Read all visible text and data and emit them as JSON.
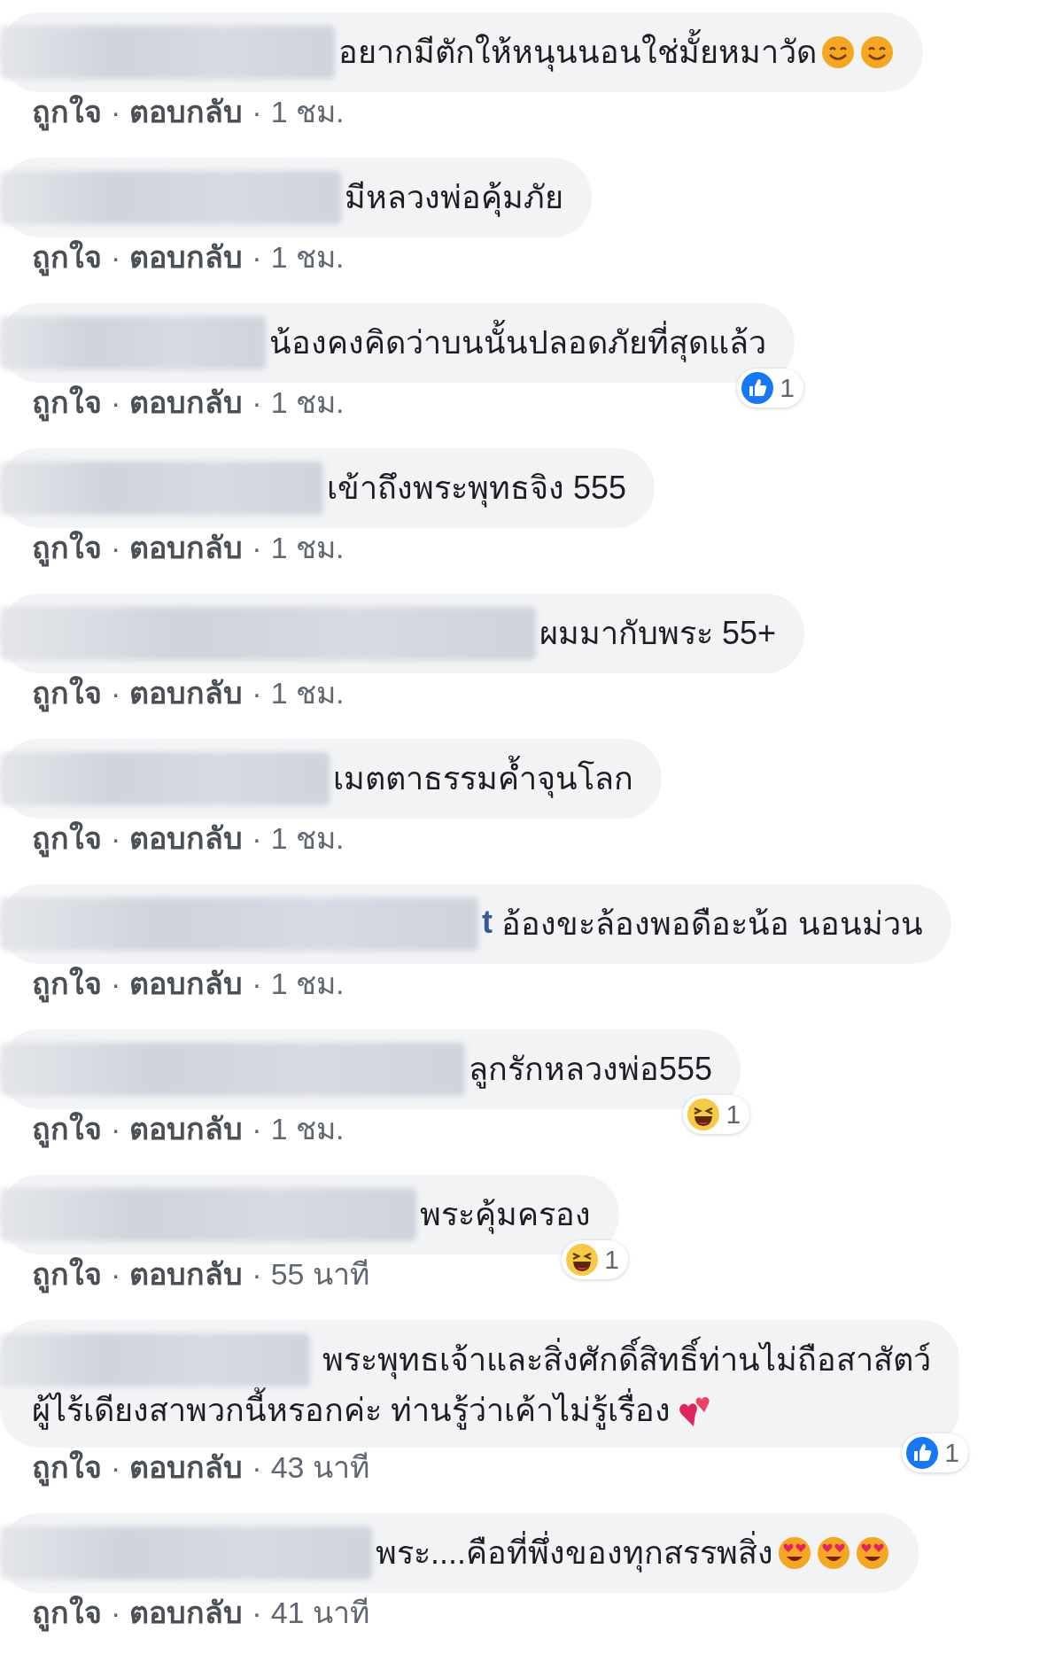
{
  "comments": [
    {
      "text": "อยากมีตักให้หนุนนอนใช่มั้ยหมาวัด",
      "emojis": [
        {
          "kind": "smiling"
        },
        {
          "kind": "smiling"
        }
      ],
      "like_label": "ถูกใจ",
      "reply_label": "ตอบกลับ",
      "separator": "·",
      "time": "1 ชม."
    },
    {
      "text": "มีหลวงพ่อคุ้มภัย",
      "like_label": "ถูกใจ",
      "reply_label": "ตอบกลับ",
      "separator": "·",
      "time": "1 ชม."
    },
    {
      "text": "น้องคงคิดว่าบนนั้นปลอดภัยที่สุดแล้ว",
      "reaction": {
        "kind": "like",
        "count": "1"
      },
      "like_label": "ถูกใจ",
      "reply_label": "ตอบกลับ",
      "separator": "·",
      "time": "1 ชม."
    },
    {
      "text": "เข้าถึงพระพุทธจิง 555",
      "like_label": "ถูกใจ",
      "reply_label": "ตอบกลับ",
      "separator": "·",
      "time": "1 ชม."
    },
    {
      "text": "ผมมากับพระ 55+",
      "like_label": "ถูกใจ",
      "reply_label": "ตอบกลับ",
      "separator": "·",
      "time": "1 ชม."
    },
    {
      "text": "เมตตาธรรมค้ำจุนโลก",
      "like_label": "ถูกใจ",
      "reply_label": "ตอบกลับ",
      "separator": "·",
      "time": "1 ชม."
    },
    {
      "name_fragment": "t",
      "text": "อ้องขะล้องพอดือะน้อ นอนม่วน",
      "like_label": "ถูกใจ",
      "reply_label": "ตอบกลับ",
      "separator": "·",
      "time": "1 ชม."
    },
    {
      "text": "ลูกรักหลวงพ่อ555",
      "reaction": {
        "kind": "haha",
        "count": "1"
      },
      "like_label": "ถูกใจ",
      "reply_label": "ตอบกลับ",
      "separator": "·",
      "time": "1 ชม."
    },
    {
      "text": "พระคุ้มครอง",
      "reaction": {
        "kind": "haha",
        "count": "1"
      },
      "like_label": "ถูกใจ",
      "reply_label": "ตอบกลับ",
      "separator": "·",
      "time": "55 นาที"
    },
    {
      "lines": [
        "พระพุทธเจ้าและสิ่งศักดิ์สิทธิ์ท่านไม่ถือสาสัตว์",
        "ผู้ไร้เดียงสาพวกนี้หรอกค่ะ ท่านรู้ว่าเค้าไม่รู้เรื่อง"
      ],
      "emojis": [
        {
          "kind": "hearts"
        }
      ],
      "reaction": {
        "kind": "like",
        "count": "1"
      },
      "like_label": "ถูกใจ",
      "reply_label": "ตอบกลับ",
      "separator": "·",
      "time": "43 นาที"
    },
    {
      "text": "พระ....คือที่พึ่งของทุกสรรพสิ่ง",
      "emojis": [
        {
          "kind": "heart-eyes"
        },
        {
          "kind": "heart-eyes"
        },
        {
          "kind": "heart-eyes"
        }
      ],
      "like_label": "ถูกใจ",
      "reply_label": "ตอบกลับ",
      "separator": "·",
      "time": "41 นาที"
    }
  ]
}
